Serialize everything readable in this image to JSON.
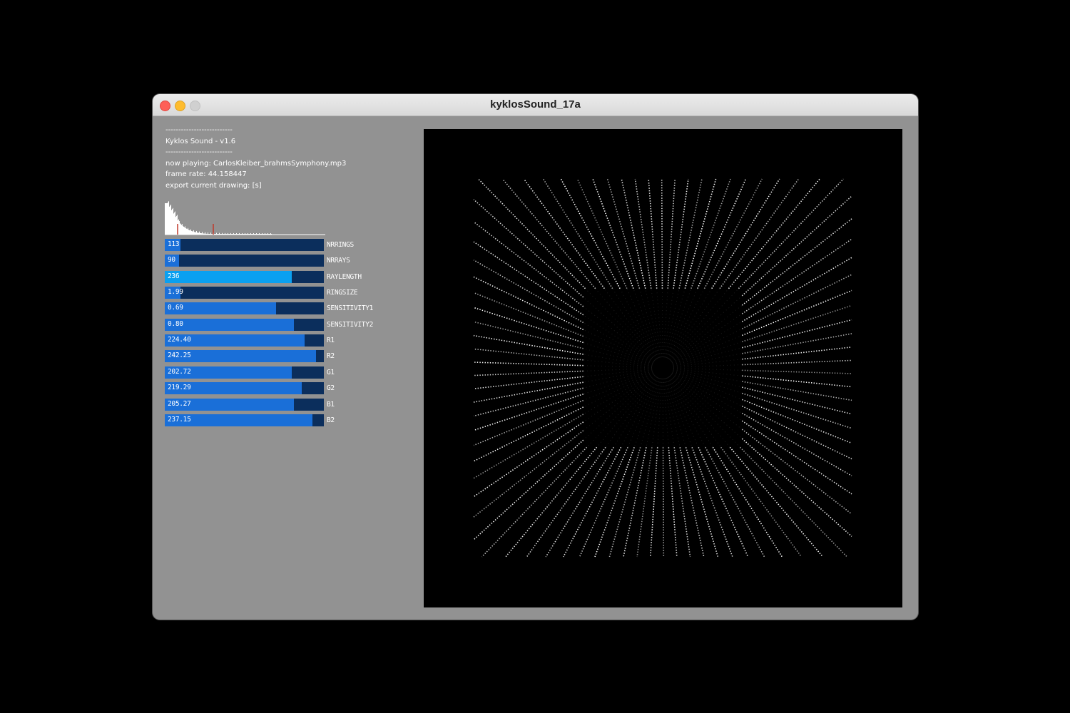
{
  "window": {
    "title": "kyklosSound_17a"
  },
  "info": {
    "separator_top": "--------------------------",
    "app_name": "Kyklos Sound - v1.6",
    "separator_bottom": "--------------------------",
    "now_playing": "now playing: CarlosKleiber_brahmsSymphony.mp3",
    "frame_rate": "frame rate: 44.158447",
    "export_hint": "export current drawing: [s]"
  },
  "sliders": [
    {
      "label": "NRRINGS",
      "display": "113",
      "fraction": 0.1,
      "active": false
    },
    {
      "label": "NRRAYS",
      "display": "90",
      "fraction": 0.09,
      "active": false
    },
    {
      "label": "RAYLENGTH",
      "display": "236",
      "fraction": 0.8,
      "active": true
    },
    {
      "label": "RINGSIZE",
      "display": "1.99",
      "fraction": 0.1,
      "active": false
    },
    {
      "label": "SENSITIVITY1",
      "display": "0.69",
      "fraction": 0.7,
      "active": false
    },
    {
      "label": "SENSITIVITY2",
      "display": "0.80",
      "fraction": 0.81,
      "active": false
    },
    {
      "label": "R1",
      "display": "224.40",
      "fraction": 0.88,
      "active": false
    },
    {
      "label": "R2",
      "display": "242.25",
      "fraction": 0.95,
      "active": false
    },
    {
      "label": "G1",
      "display": "202.72",
      "fraction": 0.8,
      "active": false
    },
    {
      "label": "G2",
      "display": "219.29",
      "fraction": 0.86,
      "active": false
    },
    {
      "label": "B1",
      "display": "205.27",
      "fraction": 0.81,
      "active": false
    },
    {
      "label": "B2",
      "display": "237.15",
      "fraction": 0.93,
      "active": false
    }
  ],
  "colors": {
    "slider_track": "#0b2e5c",
    "slider_fill": "#1a6fd8",
    "slider_fill_active": "#0aa0f0",
    "histogram_marker": "#c0392b",
    "canvas_bg": "#000000"
  }
}
